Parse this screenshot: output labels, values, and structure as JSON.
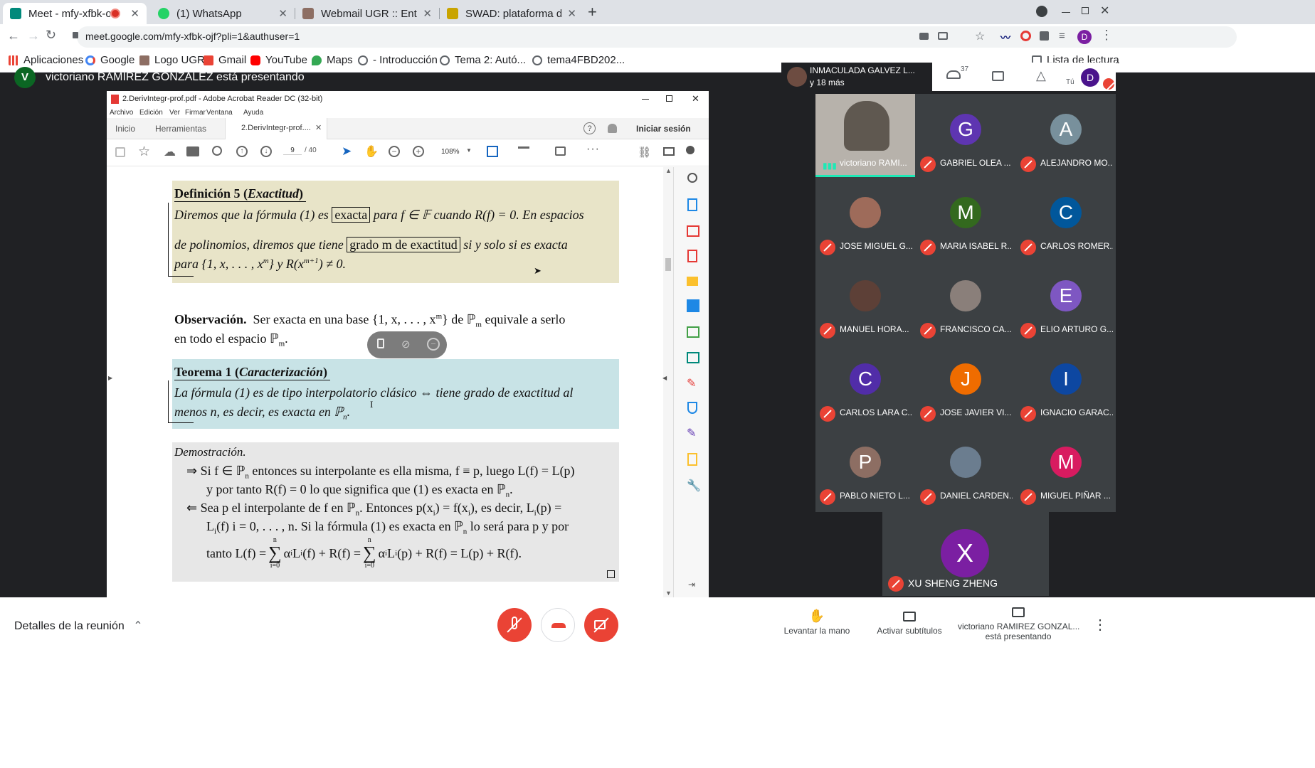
{
  "browser": {
    "tabs": [
      {
        "title": "Meet - mfy-xfbk-ojf",
        "color": "#00897b"
      },
      {
        "title": "(1) WhatsApp",
        "color": "#25d366"
      },
      {
        "title": "Webmail UGR :: Entrada",
        "color": "#8d6e63"
      },
      {
        "title": "SWAD: plataforma de apo",
        "color": "#c9a400"
      }
    ],
    "url": "meet.google.com/mfy-xfbk-ojf?pli=1&authuser=1",
    "profile_initial": "D",
    "bookmarks": [
      "Aplicaciones",
      "Google",
      "Logo UGR",
      "Gmail",
      "YouTube",
      "Maps",
      "- Introducción",
      "Tema 2: Autó...",
      "tema4FBD202..."
    ],
    "reading_list": "Lista de lectura"
  },
  "meet": {
    "presenter_banner": "victoriano RAMIREZ GONZALEZ está presentando",
    "presenter_initial": "V",
    "top_participant": {
      "name": "INMACULADA GALVEZ L...",
      "others": "y 18 más"
    },
    "participants_count": "37",
    "you_label": "Tú",
    "you_initial": "D",
    "participants": [
      {
        "name": "victoriano RAMI...",
        "initial": "",
        "color": "#6d6a66"
      },
      {
        "name": "GABRIEL OLEA ...",
        "initial": "G",
        "color": "#5e35b1"
      },
      {
        "name": "ALEJANDRO MO...",
        "initial": "A",
        "color": "#78909c"
      },
      {
        "name": "JOSE MIGUEL G...",
        "initial": "",
        "color": "#9e6b5a"
      },
      {
        "name": "MARIA ISABEL R...",
        "initial": "M",
        "color": "#33691e"
      },
      {
        "name": "CARLOS ROMER...",
        "initial": "C",
        "color": "#01579b"
      },
      {
        "name": "MANUEL HORA...",
        "initial": "",
        "color": "#5d4037"
      },
      {
        "name": "FRANCISCO CA...",
        "initial": "",
        "color": "#8a7f7a"
      },
      {
        "name": "ELIO ARTURO G...",
        "initial": "E",
        "color": "#7e57c2"
      },
      {
        "name": "CARLOS LARA C...",
        "initial": "C",
        "color": "#512da8"
      },
      {
        "name": "JOSE JAVIER VI...",
        "initial": "J",
        "color": "#ef6c00"
      },
      {
        "name": "IGNACIO GARAC...",
        "initial": "I",
        "color": "#0d47a1"
      },
      {
        "name": "PABLO NIETO L...",
        "initial": "P",
        "color": "#8d6e63"
      },
      {
        "name": "DANIEL CARDEN...",
        "initial": "",
        "color": "#6b7d8f"
      },
      {
        "name": "MIGUEL PIÑAR ...",
        "initial": "M",
        "color": "#d81b60"
      }
    ],
    "last_participant": {
      "name": "XU SHENG ZHENG",
      "initial": "X",
      "color": "#7b1fa2"
    },
    "bottom": {
      "details": "Detalles de la reunión",
      "raise_hand": "Levantar la mano",
      "captions": "Activar subtítulos",
      "presenting_line1": "victoriano RAMIREZ GONZAL...",
      "presenting_line2": "está presentando"
    }
  },
  "acrobat": {
    "window_title": "2.DerivIntegr-prof.pdf - Adobe Acrobat Reader DC (32-bit)",
    "menu": [
      "Archivo",
      "Edición",
      "Ver",
      "Firmar",
      "Ventana",
      "Ayuda"
    ],
    "tabs": {
      "home": "Inicio",
      "tools": "Herramientas",
      "doc": "2.DerivIntegr-prof....",
      "signin": "Iniciar sesión"
    },
    "page_current": "9",
    "page_total": "/ 40",
    "zoom": "108%"
  },
  "pdf": {
    "def_title": "Definición 5 (",
    "def_title_it": "Exactitud",
    "def_title_end": ")",
    "def_l1a": "Diremos que la fórmula (1) es",
    "def_box1": "exacta",
    "def_l1b": "para f ∈ 𝔽 cuando R(f) = 0. En espacios",
    "def_l2a": "de polinomios, diremos que tiene",
    "def_box2": "grado m de exactitud",
    "def_l2b": "si y solo si es exacta",
    "def_l3": "para {1, x, . . . , x",
    "def_l3_sup": "m",
    "def_l3b": "} y R(x",
    "def_l3_sup2": "m+1",
    "def_l3c": ") ≠ 0.",
    "obs_bold": "Observación.",
    "obs_l1": "Ser exacta en una base {1, x, . . . , x",
    "obs_l1_sup": "m",
    "obs_l1b": "} de ℙ",
    "obs_sub": "m",
    "obs_l1c": "equivale a serlo",
    "obs_l2": "en todo el espacio ℙ",
    "obs_l2_sub": "m",
    "obs_l2c": ".",
    "thm_title": "Teorema 1 (",
    "thm_title_it": "Caracterización",
    "thm_title_end": ")",
    "thm_l1": "La fórmula (1) es de tipo interpolatorio clásico ⇔ tiene grado de exactitud al",
    "thm_l2": "menos n, es decir, es exacta en ℙ",
    "thm_l2_sub": "n",
    "thm_l2c": ".",
    "dem_title": "Demostración.",
    "dem_l1": "⇒  Si f ∈ ℙ",
    "dem_l1_sub": "n",
    "dem_l1b": "entonces su interpolante es ella misma, f ≡ p, luego L(f) = L(p)",
    "dem_l2": "y por tanto R(f) = 0 lo que significa que (1) es exacta en ℙ",
    "dem_l2_sub": "n",
    "dem_l2c": ".",
    "dem_l3": "⇐  Sea p el interpolante de f en ℙ",
    "dem_l3_sub": "n",
    "dem_l3b": ". Entonces p(x",
    "dem_l3_sub2": "i",
    "dem_l3c": ") = f(x",
    "dem_l3_sub3": "i",
    "dem_l3d": "), es decir, L",
    "dem_l3_sub4": "i",
    "dem_l3e": "(p) =",
    "dem_l4": "L",
    "dem_l4_sub": "i",
    "dem_l4b": "(f)  i = 0, . . . , n. Si la fórmula (1) es exacta en ℙ",
    "dem_l4_sub2": "n",
    "dem_l4c": "lo será para p y por",
    "dem_l5a": "tanto L(f) =",
    "dem_l5b": "α",
    "dem_l5c": "L",
    "dem_l5d": "(f) + R(f) =",
    "dem_l5e": "α",
    "dem_l5f": "L",
    "dem_l5g": "(p) + R(f) = L(p) + R(f).",
    "sum_top": "n",
    "sum_sym": "∑",
    "sum_bot": "i=0",
    "sub_i": "i"
  }
}
